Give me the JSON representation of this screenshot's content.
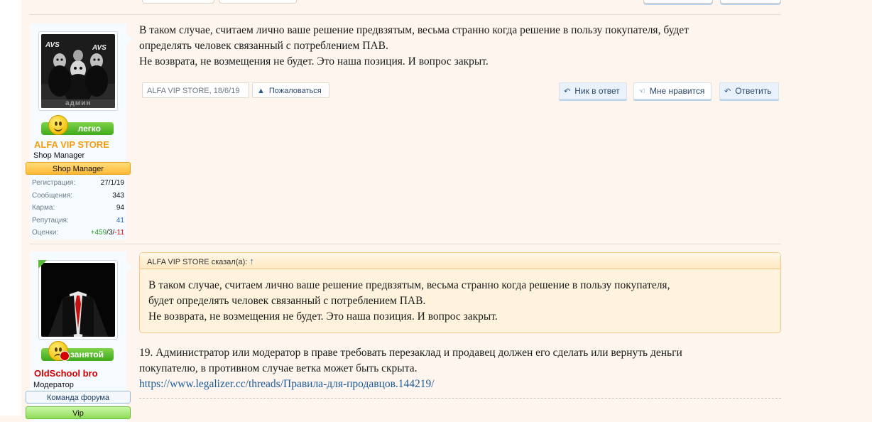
{
  "posts": [
    {
      "user": {
        "name": "ALFA VIP STORE",
        "title": "Shop Manager",
        "banner": "Shop Manager",
        "mood": "легко",
        "avatar_text": "AVS",
        "avatar_caption": "админ",
        "stats": [
          {
            "label": "Регистрация:",
            "value": "27/1/19"
          },
          {
            "label": "Сообщения:",
            "value": "343"
          },
          {
            "label": "Карма:",
            "value": "94"
          },
          {
            "label": "Репутация:",
            "value": "41"
          }
        ],
        "ratings_label": "Оценки:",
        "ratings_pos": "+459",
        "ratings_sep1": "/",
        "ratings_neu": "3",
        "ratings_sep2": "/",
        "ratings_neg": "-11"
      },
      "message": {
        "line1": "В таком случае, считаем лично ваше решение предвзятым, весьма странно когда решение в пользу покупателя, будет",
        "line2": "определять человек связанный с потреблением ПАВ.",
        "line3": "Не возврата, не возмещения не будет. Это наша позиция. И вопрос закрыт."
      },
      "meta": {
        "author": "ALFA VIP STORE",
        "date": ", 18/6/19",
        "report": "Пожаловаться",
        "nick_reply": "Ник в ответ",
        "like": "Мне нравится",
        "reply": "Ответить"
      }
    },
    {
      "user": {
        "name": "OldSchool bro",
        "title": "Модератор",
        "banner": "Команда форума",
        "banner2": "Vip",
        "mood": "занятой"
      },
      "quote": {
        "header": "ALFA VIP STORE сказал(а):",
        "up": "↑",
        "line1": "В таком случае, считаем лично ваше решение предвзятым, весьма странно когда решение в пользу покупателя,",
        "line2": "будет определять человек связанный с потреблением ПАВ.",
        "line3": "Не возврата, не возмещения не будет. Это наша позиция. И вопрос закрыт."
      },
      "message": {
        "line1": "19. Администратор или модератор в праве требовать перезаклад и продавец должен его сделать или вернуть деньги",
        "line2": "покупателю, в противном случае ветка может быть скрыта.",
        "link": "https://www.legalizer.cc/threads/Правила-для-продавцов.144219/"
      }
    }
  ],
  "colors": {
    "background": "#fdf5ee",
    "admin_name": "#f39c12",
    "moderator_name": "#d40000",
    "positive": "#2e9e2e",
    "negative": "#d40000",
    "link": "#1b5a9a"
  }
}
